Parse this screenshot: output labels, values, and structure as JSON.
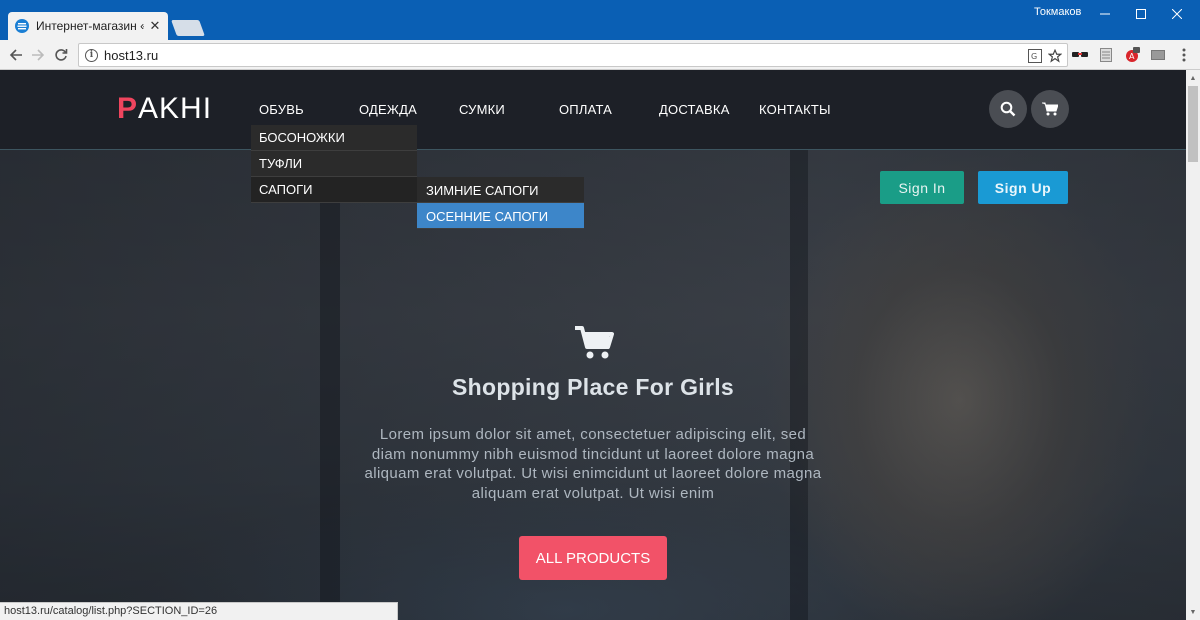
{
  "browser": {
    "tab_title": "Интернет-магазин «Оде",
    "tab_close": "✕",
    "user_name": "Токмаков",
    "url": "host13.ru",
    "status_url": "host13.ru/catalog/list.php?SECTION_ID=26"
  },
  "site": {
    "logo_first": "P",
    "logo_rest": "AKHI",
    "nav": [
      "ОБУВЬ",
      "ОДЕЖДА",
      "СУМКИ",
      "ОПЛАТА",
      "ДОСТАВКА",
      "КОНТАКТЫ"
    ],
    "dropdown": [
      "БОСОНОЖКИ",
      "ТУФЛИ",
      "САПОГИ"
    ],
    "submenu": [
      "ЗИМНИЕ САПОГИ",
      "ОСЕННИЕ САПОГИ"
    ],
    "sign_in": "Sign In",
    "sign_up": "Sign Up"
  },
  "hero": {
    "title": "Shopping Place For Girls",
    "text": "Lorem ipsum dolor sit amet, consectetuer adipiscing elit, sed diam nonummy nibh euismod tincidunt ut laoreet dolore magna aliquam erat volutpat. Ut wisi enimcidunt ut laoreet dolore magna aliquam erat volutpat. Ut wisi enim",
    "button": "ALL PRODUCTS"
  },
  "colors": {
    "brand": "#f0455e",
    "sign_in": "#1a9d87",
    "sign_up": "#1a9ad4",
    "submenu_highlight": "#3d86c9",
    "cta": "#f25268"
  }
}
